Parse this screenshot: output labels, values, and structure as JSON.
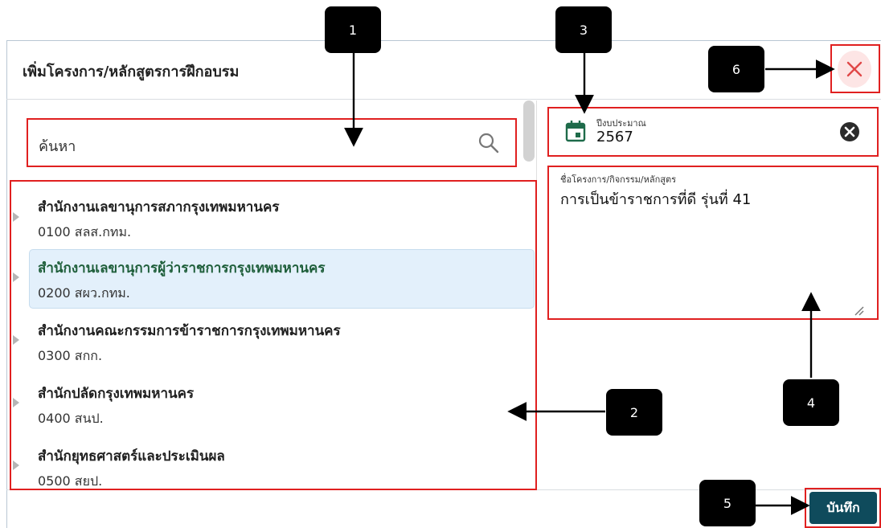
{
  "dialog": {
    "title": "เพิ่มโครงการ/หลักสูตรการฝึกอบรม"
  },
  "search": {
    "placeholder": "ค้นหา",
    "icon": "search-icon"
  },
  "orgs": [
    {
      "name": "สำนักงานเลขานุการสภากรุงเทพมหานคร",
      "code": "0100 สลส.กทม."
    },
    {
      "name": "สำนักงานเลขานุการผู้ว่าราชการกรุงเทพมหานคร",
      "code": "0200 สผว.กทม."
    },
    {
      "name": "สำนักงานคณะกรรมการข้าราชการกรุงเทพมหานคร",
      "code": "0300 สกก."
    },
    {
      "name": "สำนักปลัดกรุงเทพมหานคร",
      "code": "0400 สนป."
    },
    {
      "name": "สำนักยุทธศาสตร์และประเมินผล",
      "code": "0500 สยป."
    }
  ],
  "fiscal_year": {
    "label": "ปีงบประมาณ",
    "value": "2567"
  },
  "project_name": {
    "label": "ชื่อโครงการ/กิจกรรม/หลักสูตร",
    "value": "การเป็นข้าราชการที่ดี รุ่นที่ 41"
  },
  "save_label": "บันทึก",
  "badges": [
    "1",
    "2",
    "3",
    "4",
    "5",
    "6"
  ],
  "colors": {
    "accent": "#0f4b5c",
    "highlight": "#e02020",
    "selected_bg": "#e3f0fb",
    "selected_text": "#1e5e3a"
  }
}
